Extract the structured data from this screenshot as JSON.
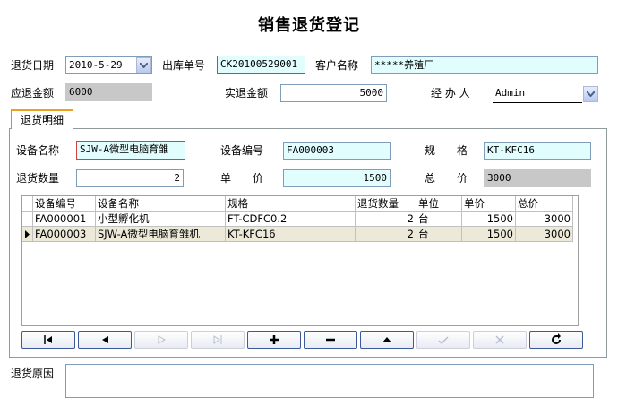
{
  "title": "销售退货登记",
  "header": {
    "return_date_label": "退货日期",
    "return_date_value": "2010-5-29",
    "outbound_no_label": "出库单号",
    "outbound_no_value": "CK20100529001",
    "customer_label": "客户名称",
    "customer_value": "*****养殖厂",
    "refund_due_label": "应退金额",
    "refund_due_value": "6000",
    "refund_actual_label": "实退金额",
    "refund_actual_value": "5000",
    "handler_label": "经 办 人",
    "handler_value": "Admin"
  },
  "tab": {
    "label": "退货明细"
  },
  "detail": {
    "device_name_label": "设备名称",
    "device_name_value": "SJW-A微型电脑育雏",
    "device_no_label": "设备编号",
    "device_no_value": "FA000003",
    "spec_label": "规　　格",
    "spec_value": "KT-KFC16",
    "qty_label": "退货数量",
    "qty_value": "2",
    "unit_price_label": "单　　价",
    "unit_price_value": "1500",
    "total_label": "总　　价",
    "total_value": "3000"
  },
  "grid": {
    "columns": [
      "设备编号",
      "设备名称",
      "规格",
      "退货数量",
      "单位",
      "单价",
      "总价"
    ],
    "rows": [
      [
        "FA000001",
        "小型孵化机",
        "FT-CDFC0.2",
        "2",
        "台",
        "1500",
        "3000"
      ],
      [
        "FA000003",
        "SJW-A微型电脑育雏机",
        "KT-KFC16",
        "2",
        "台",
        "1500",
        "3000"
      ]
    ],
    "selected_row": 1
  },
  "nav_buttons": [
    {
      "name": "first-record-button",
      "icon": "first-icon",
      "enabled": true
    },
    {
      "name": "prior-record-button",
      "icon": "prior-icon",
      "enabled": true
    },
    {
      "name": "next-record-button",
      "icon": "next-icon",
      "enabled": false
    },
    {
      "name": "last-record-button",
      "icon": "last-icon",
      "enabled": false
    },
    {
      "name": "insert-button",
      "icon": "plus-icon",
      "enabled": true
    },
    {
      "name": "delete-button",
      "icon": "minus-icon",
      "enabled": true
    },
    {
      "name": "edit-button",
      "icon": "up-triangle-icon",
      "enabled": true
    },
    {
      "name": "post-button",
      "icon": "check-icon",
      "enabled": false
    },
    {
      "name": "cancel-button",
      "icon": "x-icon",
      "enabled": false
    },
    {
      "name": "refresh-button",
      "icon": "refresh-icon",
      "enabled": true
    }
  ],
  "reason": {
    "label": "退货原因",
    "value": ""
  }
}
